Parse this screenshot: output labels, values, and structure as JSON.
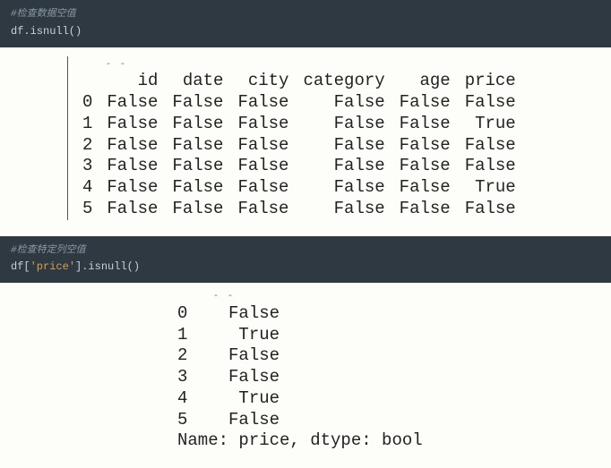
{
  "code1": {
    "comment": "#检查数据空值",
    "line": "df.isnull()"
  },
  "table1": {
    "columns": [
      "id",
      "date",
      "city",
      "category",
      "age",
      "price"
    ],
    "rows": [
      {
        "idx": "0",
        "vals": [
          "False",
          "False",
          "False",
          "False",
          "False",
          "False"
        ]
      },
      {
        "idx": "1",
        "vals": [
          "False",
          "False",
          "False",
          "False",
          "False",
          "True"
        ]
      },
      {
        "idx": "2",
        "vals": [
          "False",
          "False",
          "False",
          "False",
          "False",
          "False"
        ]
      },
      {
        "idx": "3",
        "vals": [
          "False",
          "False",
          "False",
          "False",
          "False",
          "False"
        ]
      },
      {
        "idx": "4",
        "vals": [
          "False",
          "False",
          "False",
          "False",
          "False",
          "True"
        ]
      },
      {
        "idx": "5",
        "vals": [
          "False",
          "False",
          "False",
          "False",
          "False",
          "False"
        ]
      }
    ]
  },
  "code2": {
    "comment": "#检查特定列空值",
    "line_pre": "df[",
    "line_str": "'price'",
    "line_post": "].isnull()"
  },
  "series": {
    "rows": [
      {
        "idx": "0",
        "val": "False"
      },
      {
        "idx": "1",
        "val": "True"
      },
      {
        "idx": "2",
        "val": "False"
      },
      {
        "idx": "3",
        "val": "False"
      },
      {
        "idx": "4",
        "val": "True"
      },
      {
        "idx": "5",
        "val": "False"
      }
    ],
    "footer": "Name: price, dtype: bool"
  },
  "chart_data": {
    "type": "table",
    "tables": [
      {
        "title": "df.isnull()",
        "columns": [
          "id",
          "date",
          "city",
          "category",
          "age",
          "price"
        ],
        "index": [
          0,
          1,
          2,
          3,
          4,
          5
        ],
        "data": [
          [
            false,
            false,
            false,
            false,
            false,
            false
          ],
          [
            false,
            false,
            false,
            false,
            false,
            true
          ],
          [
            false,
            false,
            false,
            false,
            false,
            false
          ],
          [
            false,
            false,
            false,
            false,
            false,
            false
          ],
          [
            false,
            false,
            false,
            false,
            false,
            true
          ],
          [
            false,
            false,
            false,
            false,
            false,
            false
          ]
        ]
      },
      {
        "title": "df['price'].isnull()",
        "name": "price",
        "dtype": "bool",
        "index": [
          0,
          1,
          2,
          3,
          4,
          5
        ],
        "data": [
          false,
          true,
          false,
          false,
          true,
          false
        ]
      }
    ]
  }
}
